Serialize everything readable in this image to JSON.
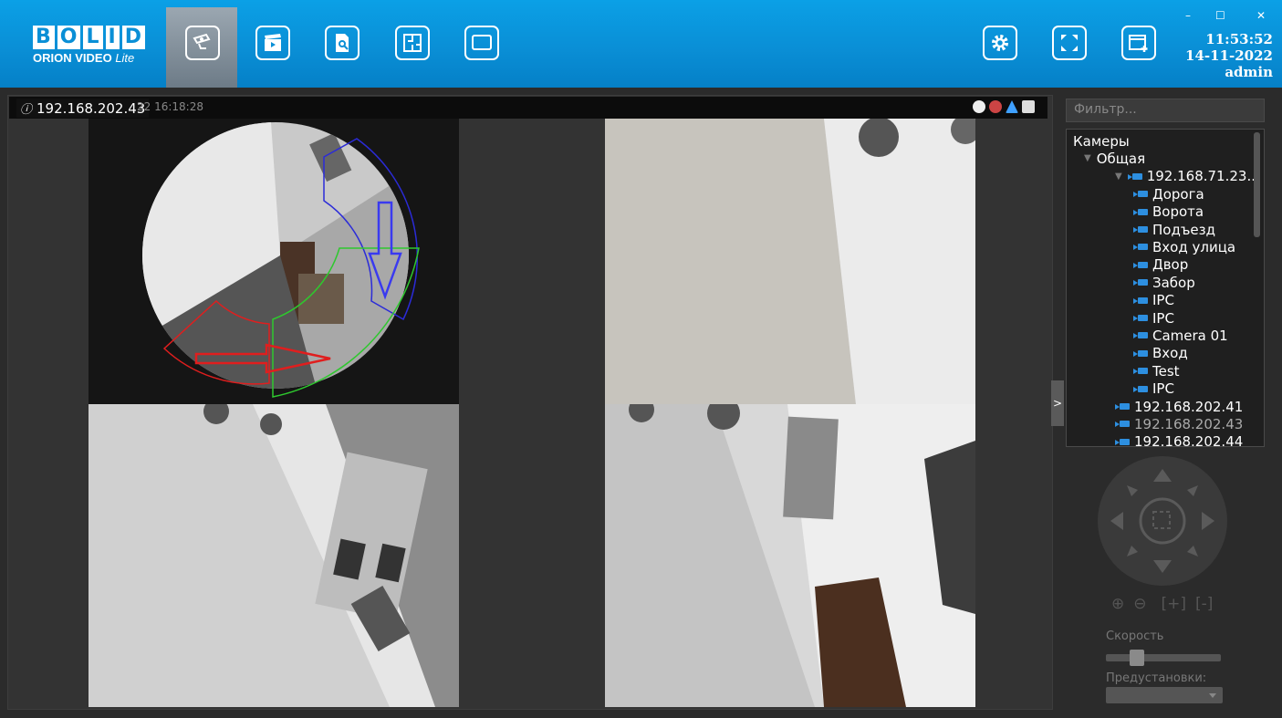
{
  "logo": {
    "brand": [
      "B",
      "O",
      "L",
      "I",
      "D"
    ],
    "product": "ORION VIDEO",
    "edition": "Lite"
  },
  "nav": [
    {
      "name": "cameras",
      "icon": "camera-icon",
      "active": true
    },
    {
      "name": "archive",
      "icon": "clapperboard-icon",
      "active": false
    },
    {
      "name": "reports",
      "icon": "document-search-icon",
      "active": false
    },
    {
      "name": "maps",
      "icon": "floor-plan-icon",
      "active": false
    },
    {
      "name": "view",
      "icon": "monitor-icon",
      "active": false
    }
  ],
  "toolbar_right": [
    {
      "name": "settings",
      "icon": "gear-icon"
    },
    {
      "name": "fullscreen",
      "icon": "fullscreen-icon"
    },
    {
      "name": "new-window",
      "icon": "add-window-icon"
    }
  ],
  "window": {
    "minimize": "–",
    "maximize": "☐",
    "close": "✕"
  },
  "clock": {
    "time": "11:53:52",
    "date": "14-11-2022",
    "user": "admin"
  },
  "video": {
    "camera_label": "192.168.202.43",
    "timestamp": "22 16:18:28",
    "overlay_icons": [
      "zoom-icon",
      "record-icon",
      "alarm-icon",
      "snapshot-icon"
    ],
    "colors": {
      "red_zone": "#e01e1e",
      "blue_zone": "#2b2bd8",
      "green_zone": "#2ec82e"
    }
  },
  "panel_toggle": ">",
  "filter": {
    "placeholder": "Фильтр..."
  },
  "tree": {
    "root": "Камеры",
    "group": "Общая",
    "server": "192.168.71.23...",
    "cameras": [
      "Дорога",
      "Ворота",
      "Подъезд",
      "Вход улица",
      "Двор",
      "Забор",
      "IPC",
      "IPC",
      "Camera 01",
      "Вход",
      "Test",
      "IPC"
    ],
    "other_servers": [
      "192.168.202.41",
      "192.168.202.43",
      "192.168.202.44"
    ]
  },
  "ptz": {
    "speed_label": "Скорость",
    "speed_value": 0.25,
    "presets_label": "Предустановки:",
    "zoom": [
      "zoom-in-icon",
      "zoom-out-icon",
      "focus-in-icon",
      "focus-out-icon"
    ]
  }
}
